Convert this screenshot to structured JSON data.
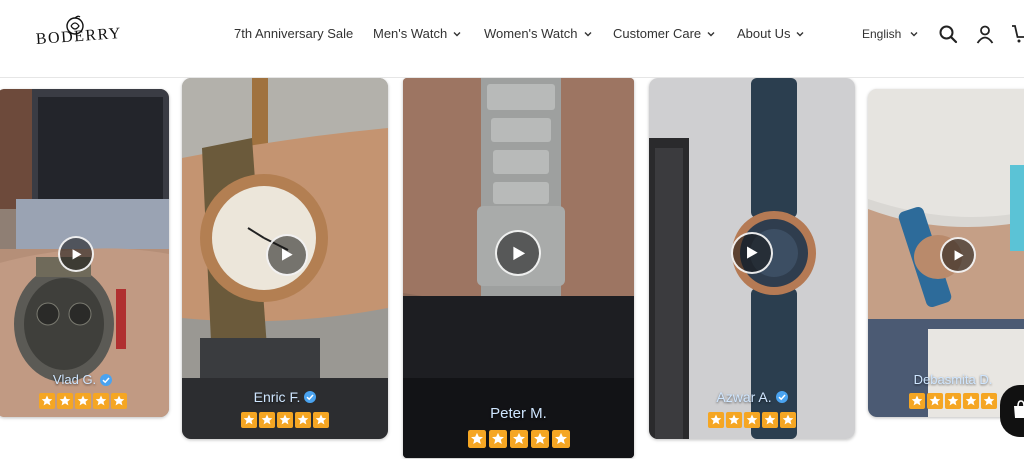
{
  "brand": {
    "name": "BODERRY"
  },
  "nav": {
    "items": [
      {
        "label": "7th Anniversary Sale",
        "has_dropdown": false
      },
      {
        "label": "Men's Watch",
        "has_dropdown": true
      },
      {
        "label": "Women's Watch",
        "has_dropdown": true
      },
      {
        "label": "Customer Care",
        "has_dropdown": true
      },
      {
        "label": "About Us",
        "has_dropdown": true
      }
    ]
  },
  "header": {
    "language": "English",
    "icons": [
      "search-icon",
      "user-icon",
      "cart-icon"
    ]
  },
  "reviews": [
    {
      "name": "Vlad G.",
      "verified": true,
      "rating": 5
    },
    {
      "name": "Enric F.",
      "verified": true,
      "rating": 5
    },
    {
      "name": "Peter M.",
      "verified": false,
      "rating": 5
    },
    {
      "name": "Azwar A.",
      "verified": true,
      "rating": 5
    },
    {
      "name": "Debasmita D.",
      "verified": false,
      "rating": 5
    }
  ],
  "colors": {
    "star": "#f5a623",
    "verified": "#4aa3f0",
    "name_text": "#cfe6ff",
    "chat_button": "#111111"
  }
}
